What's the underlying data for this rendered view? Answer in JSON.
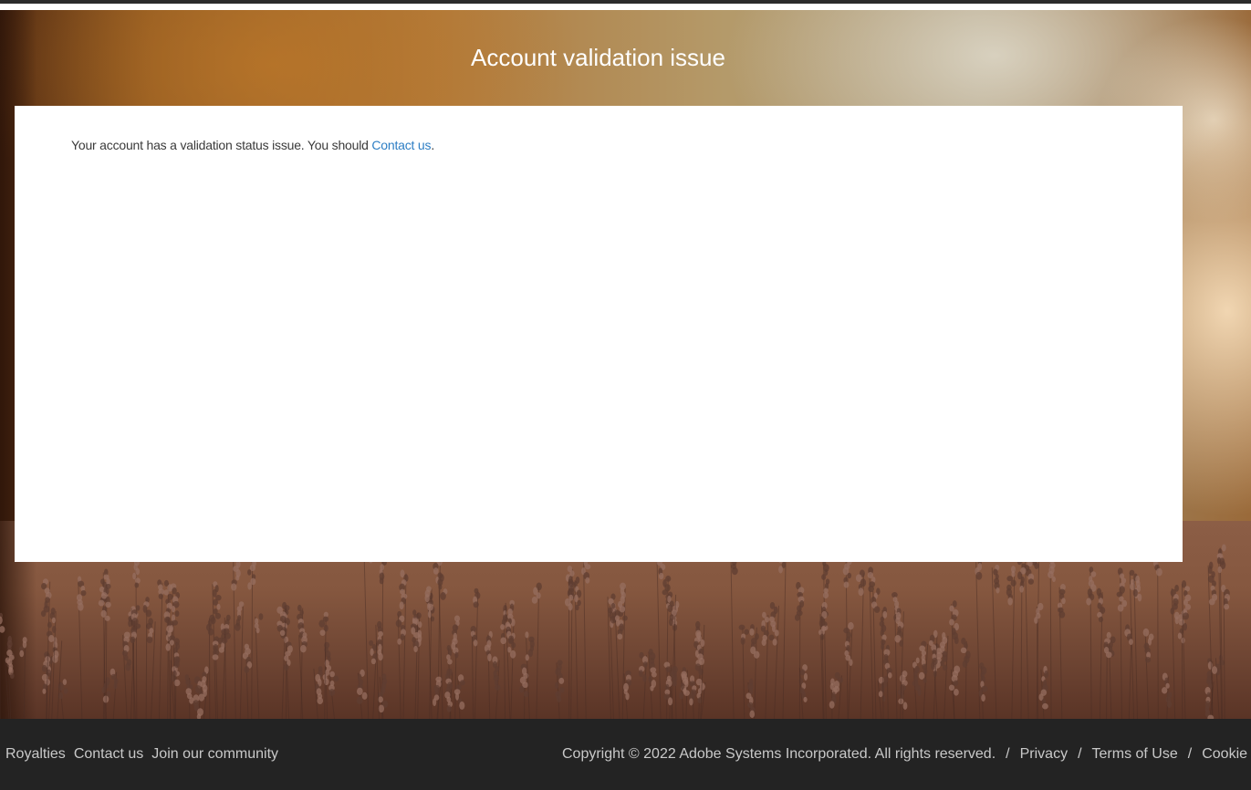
{
  "page": {
    "title": "Account validation issue"
  },
  "message": {
    "text": "Your account has a validation status issue. You should ",
    "link_label": "Contact us",
    "suffix": "."
  },
  "footer": {
    "left_links": [
      "Royalties",
      "Contact us",
      "Join our community"
    ],
    "copyright": "Copyright © 2022 Adobe Systems Incorporated. All rights reserved.",
    "separator": "/",
    "right_links": [
      "Privacy",
      "Terms of Use",
      "Cookie"
    ]
  },
  "colors": {
    "link": "#2d7ec4",
    "footer_bg": "#232323",
    "footer_text": "#c9c9c9"
  }
}
